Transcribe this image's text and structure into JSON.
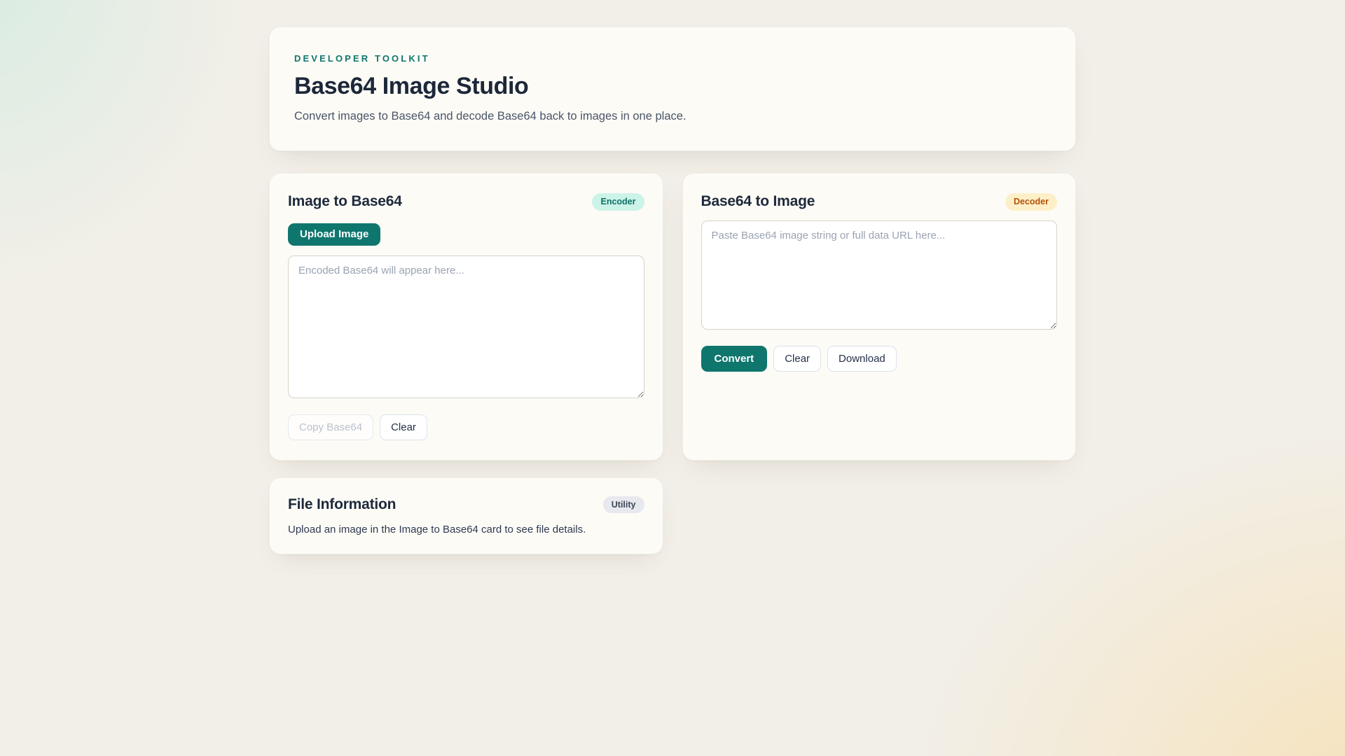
{
  "page": {
    "eyebrow": "DEVELOPER TOOLKIT",
    "title": "Base64 Image Studio",
    "subtitle": "Convert images to Base64 and decode Base64 back to images in one place."
  },
  "encoder_card": {
    "title": "Image to Base64",
    "badge": "Encoder",
    "upload_button": "Upload Image",
    "output_placeholder": "Encoded Base64 will appear here...",
    "output_value": "",
    "copy_button": "Copy Base64",
    "clear_button": "Clear"
  },
  "decoder_card": {
    "title": "Base64 to Image",
    "badge": "Decoder",
    "input_placeholder": "Paste Base64 image string or full data URL here...",
    "input_value": "",
    "convert_button": "Convert",
    "clear_button": "Clear",
    "download_button": "Download"
  },
  "file_info_card": {
    "title": "File Information",
    "badge": "Utility",
    "empty_message": "Upload an image in the Image to Base64 card to see file details."
  },
  "colors": {
    "accent_teal": "#0f766e",
    "page_bg": "#f2efe8",
    "card_bg": "#fcfbf6",
    "encoder_badge_bg": "#ccf3e8",
    "encoder_badge_text": "#0c7066",
    "decoder_badge_bg": "#fdf0c9",
    "decoder_badge_text": "#b45309",
    "utility_badge_bg": "#e8e9ee",
    "utility_badge_text": "#3b4557",
    "gradient_top_left": "#d9ece2",
    "gradient_bottom_right": "#f6e2ba"
  }
}
